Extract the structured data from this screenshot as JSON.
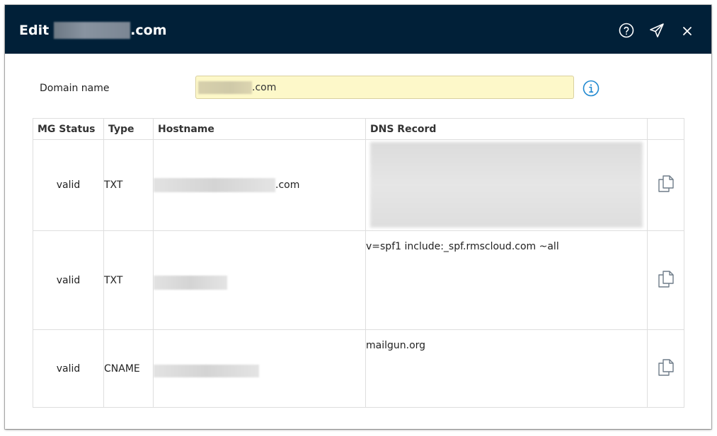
{
  "dialog": {
    "title_prefix": "Edit",
    "title_suffix": ".com"
  },
  "header_icons": [
    "help-icon",
    "send-icon",
    "close-icon"
  ],
  "domain": {
    "label": "Domain name",
    "value_suffix": ".com"
  },
  "table": {
    "headers": [
      "MG Status",
      "Type",
      "Hostname",
      "DNS Record"
    ],
    "rows": [
      {
        "status": "valid",
        "type": "TXT",
        "hostname_suffix": ".com",
        "dns_record": ""
      },
      {
        "status": "valid",
        "type": "TXT",
        "hostname_suffix": "",
        "dns_record": "v=spf1 include:_spf.rmscloud.com ~all"
      },
      {
        "status": "valid",
        "type": "CNAME",
        "hostname_suffix": "",
        "dns_record": "mailgun.org"
      }
    ]
  },
  "colors": {
    "header_bg": "#012038",
    "field_bg": "#fdf8c9",
    "info_blue": "#1e88d0"
  }
}
